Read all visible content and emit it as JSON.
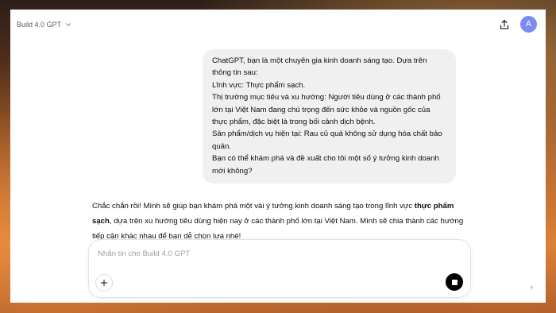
{
  "header": {
    "model_name": "Build 4.0 GPT",
    "avatar_initial": "A"
  },
  "conversation": {
    "user_message_lines": [
      "ChatGPT, bạn là một chuyên gia kinh doanh sáng tạo. Dựa trên thông tin sau:",
      "Lĩnh vực: Thực phẩm sạch.",
      "Thị trường mục tiêu và xu hướng: Người tiêu dùng ở các thành phố lớn tại Việt Nam đang chú trọng đến sức khỏe và nguồn gốc của thực phẩm, đặc biệt là trong bối cảnh dịch bệnh.",
      "Sản phẩm/dịch vụ hiện tại: Rau củ quả không sử dụng hóa chất bảo quản.",
      "Bạn có thể khám phá và đề xuất cho tôi một số ý tưởng kinh doanh mới không?"
    ],
    "assistant_message": {
      "part1": "Chắc chắn rồi! Mình sẽ giúp bạn khám phá một vài ý tưởng kinh doanh sáng tạo trong lĩnh vực ",
      "bold": "thực phẩm sạch",
      "part2": ", dựa trên xu hướng tiêu dùng hiện nay ở các thành phố lớn tại Việt Nam. Mình sẽ chia thành các hướng tiếp cận khác nhau để bạn dễ chọn lựa nhé!"
    }
  },
  "composer": {
    "placeholder": "Nhắn tin cho Build 4.0 GPT",
    "value": ""
  },
  "footer": {
    "help_label": "?"
  },
  "icons": {
    "model": "chevron-down-icon",
    "share": "share-icon",
    "attach": "plus-icon",
    "stop": "stop-icon"
  },
  "colors": {
    "avatar": "#7b8cf0",
    "user_bubble": "#f0f0f0",
    "stop_button": "#000000"
  }
}
